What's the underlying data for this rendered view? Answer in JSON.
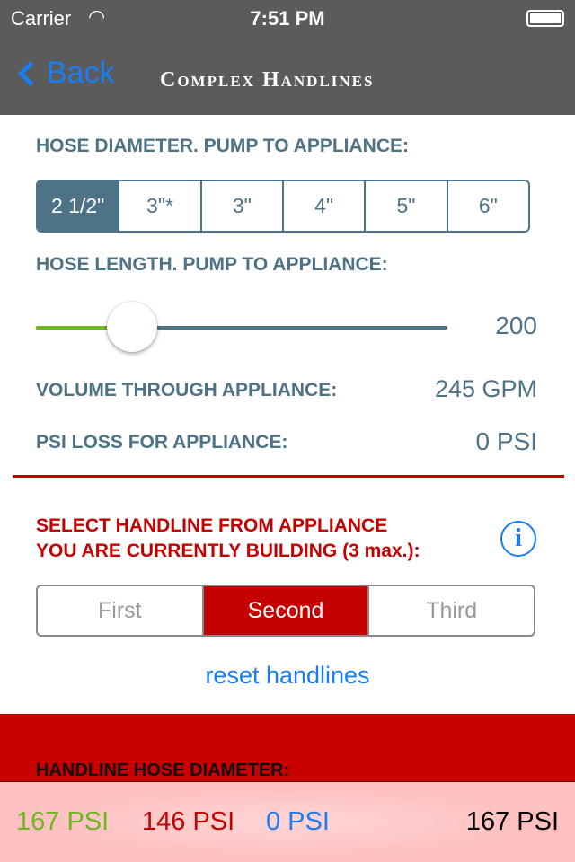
{
  "status_bar": {
    "carrier": "Carrier",
    "time": "7:51 PM",
    "wifi_icon": "wifi-icon",
    "battery_icon": "battery-full-icon"
  },
  "nav": {
    "back_label": "Back",
    "title": "Complex Handlines"
  },
  "hose_diameter": {
    "label": "HOSE DIAMETER. PUMP TO APPLIANCE:",
    "options": [
      "2 1/2\"",
      "3\"*",
      "3\"",
      "4\"",
      "5\"",
      "6\""
    ],
    "selected": "2 1/2\""
  },
  "hose_length": {
    "label": "HOSE LENGTH. PUMP TO APPLIANCE:",
    "value": "200",
    "slider_fraction": 0.23
  },
  "volume": {
    "label": "VOLUME THROUGH APPLIANCE:",
    "value": "245 GPM"
  },
  "psi_loss": {
    "label": "PSI LOSS FOR APPLIANCE:",
    "value": "0 PSI"
  },
  "handline_select": {
    "label_line1": "SELECT HANDLINE FROM APPLIANCE",
    "label_line2": "YOU ARE CURRENTLY BUILDING (3 max.):",
    "info_icon": "i",
    "options": [
      "First",
      "Second",
      "Third"
    ],
    "selected": "Second"
  },
  "reset_label": "reset handlines",
  "handline_hose_label": "HANDLINE HOSE DIAMETER:",
  "summary": {
    "first": "167 PSI",
    "second": "146 PSI",
    "third": "0 PSI",
    "total": "167 PSI"
  },
  "colors": {
    "accent": "#4e7286",
    "red": "#c40000",
    "blue": "#1a7ef2",
    "green": "#6cb81f"
  }
}
